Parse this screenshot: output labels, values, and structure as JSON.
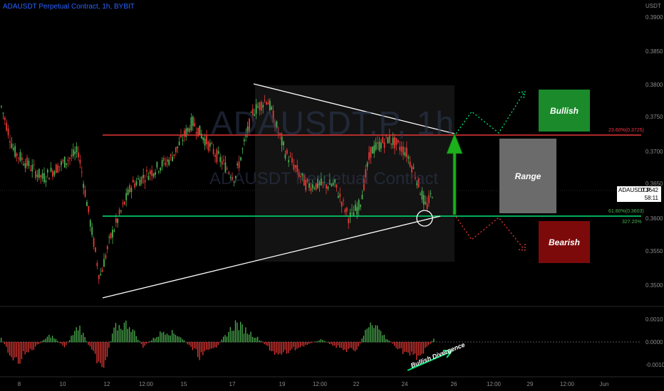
{
  "header": {
    "symbol_line": "ADAUSDT Perpetual Contract, 1h, BYBIT"
  },
  "watermark": {
    "big": "ADAUSDT.P, 1h",
    "small": "ADAUSDT Perpetual Contract"
  },
  "price_axis": {
    "unit": "USDT",
    "ticks": [
      "0.3900",
      "0.3850",
      "0.3800",
      "0.3750",
      "0.3700",
      "0.3650",
      "0.3600",
      "0.3550",
      "0.3500"
    ]
  },
  "osc_axis": {
    "ticks": [
      "0.0010",
      "0.0000",
      "-0.0010"
    ]
  },
  "time_axis": {
    "ticks": [
      "8",
      "10",
      "12",
      "12:00",
      "15",
      "17",
      "19",
      "12:00",
      "22",
      "24",
      "26",
      "12:00",
      "29",
      "12:00",
      "Jun"
    ]
  },
  "price_tag": {
    "symbol": "ADAUSDT.P",
    "price": "0.3642",
    "countdown": "58:11"
  },
  "fib": {
    "upper": "23.60%(0.3725)",
    "lower": "61.80%(0.3603)",
    "ext": "327.20%"
  },
  "boxes": {
    "bullish": "Bullish",
    "range": "Range",
    "bearish": "Bearish"
  },
  "annotation": {
    "divergence": "Bullish Divergence"
  },
  "colors": {
    "up": "#26a69a",
    "candle_up": "#4caf50",
    "candle_down": "#e53935",
    "resistance": "#e53935",
    "support": "#00e676",
    "bull_box": "#1b8a2b",
    "range_box": "#6b6b6b",
    "bear_box": "#8b0000"
  }
}
